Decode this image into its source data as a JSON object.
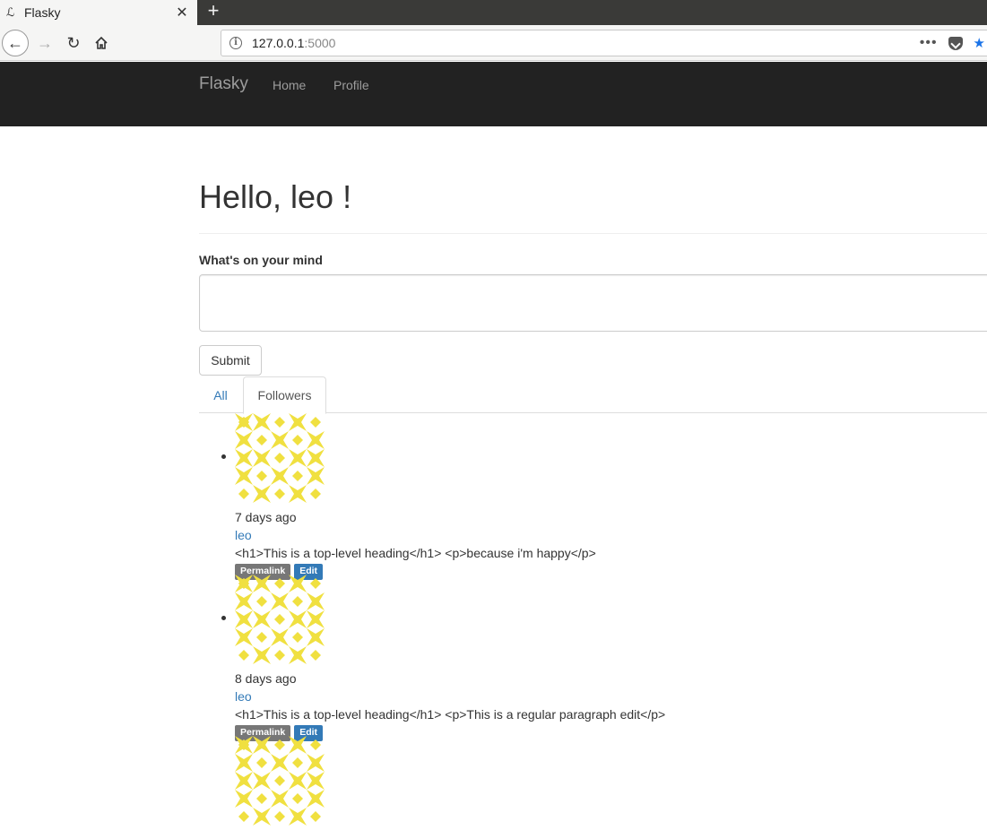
{
  "browser": {
    "tab_title": "Flasky",
    "url_host": "127.0.0.1",
    "url_port": ":5000",
    "icons": [
      "favicon-icon",
      "close-icon",
      "plus-icon",
      "back-icon",
      "forward-icon",
      "reload-icon",
      "home-icon",
      "info-icon",
      "more-icon",
      "pocket-icon",
      "star-icon"
    ]
  },
  "site": {
    "brand": "Flasky",
    "nav": {
      "home": "Home",
      "profile": "Profile"
    }
  },
  "main": {
    "greeting": "Hello, leo !",
    "form_label": "What's on your mind",
    "submit": "Submit",
    "tabs": {
      "all": "All",
      "followers": "Followers"
    }
  },
  "posts": [
    {
      "date": "7 days ago",
      "author": "leo",
      "body": "<h1>This is a top-level heading</h1> <p>because i'm happy</p>",
      "permalink": "Permalink",
      "edit": "Edit"
    },
    {
      "date": "8 days ago",
      "author": "leo",
      "body": "<h1>This is a top-level heading</h1> <p>This is a regular paragraph edit</p>",
      "permalink": "Permalink",
      "edit": "Edit"
    }
  ],
  "colors": {
    "navbar_bg": "#222222",
    "link": "#337ab7",
    "avatar": "#f0e040"
  }
}
